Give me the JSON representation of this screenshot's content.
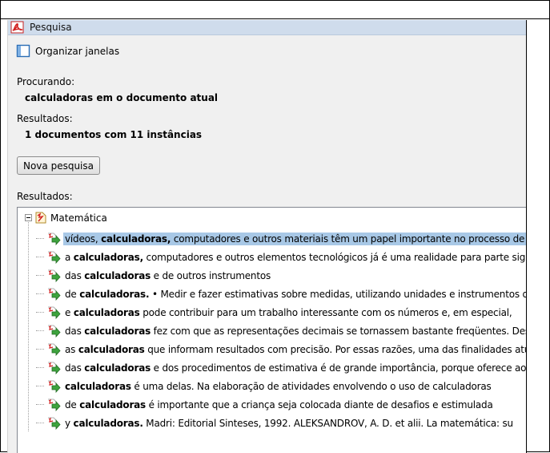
{
  "panel": {
    "title": "Pesquisa",
    "organize_label": "Organizar janelas"
  },
  "search": {
    "searching_label": "Procurando:",
    "searching_value": "calculadoras em o documento atual",
    "results_label": "Resultados:",
    "results_value": "1 documentos com 11 instâncias",
    "new_search_button": "Nova pesquisa",
    "results_list_label": "Resultados:"
  },
  "tree": {
    "root_label": "Matemática",
    "items": [
      {
        "pre": "vídeos, ",
        "term": "calculadoras,",
        "post": " computadores e outros materiais têm um papel importante no processo de ensino",
        "selected": true
      },
      {
        "pre": "a ",
        "term": "calculadoras,",
        "post": " computadores e outros elementos tecnológicos já é uma realidade para parte significativa",
        "selected": false
      },
      {
        "pre": "das ",
        "term": "calculadoras",
        "post": " e de outros instrumentos",
        "selected": false
      },
      {
        "pre": "de ",
        "term": "calculadoras.",
        "post": " • Medir e fazer estimativas sobre medidas, utilizando unidades e instrumentos de",
        "selected": false
      },
      {
        "pre": "e ",
        "term": "calculadoras",
        "post": " pode contribuir para um trabalho interessante com os números e, em especial,",
        "selected": false
      },
      {
        "pre": "das ",
        "term": "calculadoras",
        "post": " fez com que as representações decimais se tornassem bastante freqüentes. Desse modo,",
        "selected": false
      },
      {
        "pre": "as ",
        "term": "calculadoras",
        "post": " que informam resultados com precisão. Por essas razões, uma das finalidades atuais",
        "selected": false
      },
      {
        "pre": "das ",
        "term": "calculadoras",
        "post": " e dos procedimentos de estimativa é de grande importância, porque oferece aos",
        "selected": false
      },
      {
        "pre": "",
        "term": "calculadoras",
        "post": " é uma delas. Na elaboração de atividades envolvendo o uso de calculadoras",
        "selected": false
      },
      {
        "pre": "de ",
        "term": "calculadoras",
        "post": " é importante que a criança seja colocada diante de desafios e estimulada",
        "selected": false
      },
      {
        "pre": "y ",
        "term": "calculadoras.",
        "post": " Madri: Editorial Sinteses, 1992. ALEKSANDROV, A. D. et alii. La matemática: su",
        "selected": false
      }
    ]
  },
  "icons": {
    "panel_icon": "pdf-icon",
    "organize_icon": "window-layout-icon",
    "root_icon": "document-icon",
    "result_icon": "result-arrow-icon"
  },
  "colors": {
    "titlebar": "#cfdcec",
    "panel_bg": "#f0f0f0",
    "selection": "#a8c8e6",
    "result_icon_green": "#3da33d",
    "pdf_red": "#d22222"
  }
}
